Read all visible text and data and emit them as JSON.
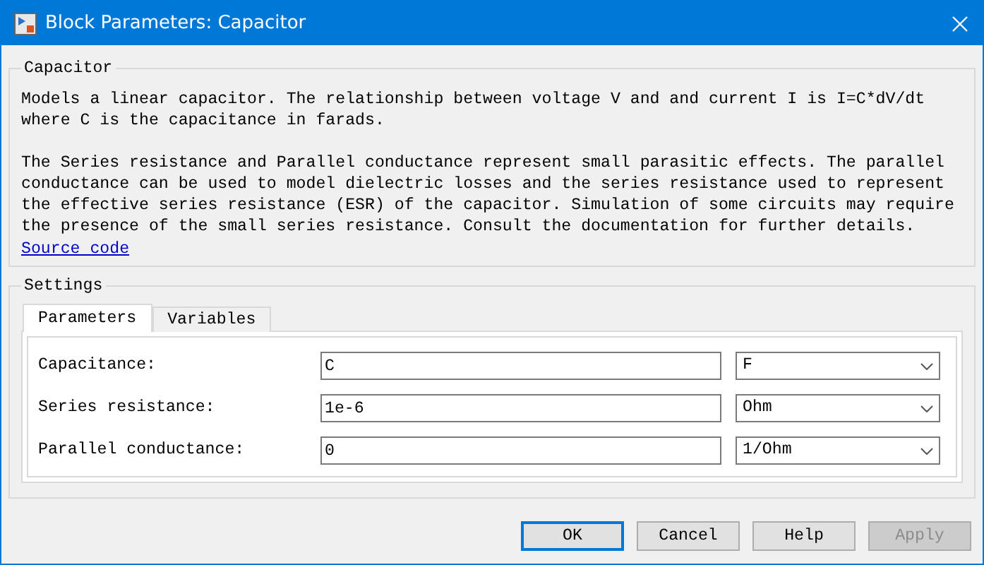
{
  "window": {
    "title": "Block Parameters: Capacitor"
  },
  "description": {
    "title": "Capacitor",
    "paragraphs": [
      "Models a linear capacitor. The relationship between voltage V and and current I is I=C*dV/dt\nwhere C is the capacitance in farads.",
      "The Series resistance and Parallel conductance represent small parasitic effects. The parallel\nconductance can be used to model dielectric losses and the series resistance used to represent\nthe effective series resistance (ESR) of the capacitor. Simulation of some circuits may require\nthe presence of the small series resistance. Consult the documentation for further details."
    ],
    "link": "Source code"
  },
  "settings": {
    "title": "Settings",
    "tabs": [
      {
        "label": "Parameters",
        "selected": true
      },
      {
        "label": "Variables",
        "selected": false
      }
    ],
    "parameters": [
      {
        "label": "Capacitance:",
        "value": "C",
        "unit": "F"
      },
      {
        "label": "Series resistance:",
        "value": "1e-6",
        "unit": "Ohm"
      },
      {
        "label": "Parallel conductance:",
        "value": "0",
        "unit": "1/Ohm"
      }
    ]
  },
  "buttons": [
    {
      "label": "OK",
      "default": true,
      "disabled": false
    },
    {
      "label": "Cancel",
      "default": false,
      "disabled": false
    },
    {
      "label": "Help",
      "default": false,
      "disabled": false
    },
    {
      "label": "Apply",
      "default": false,
      "disabled": true
    }
  ]
}
